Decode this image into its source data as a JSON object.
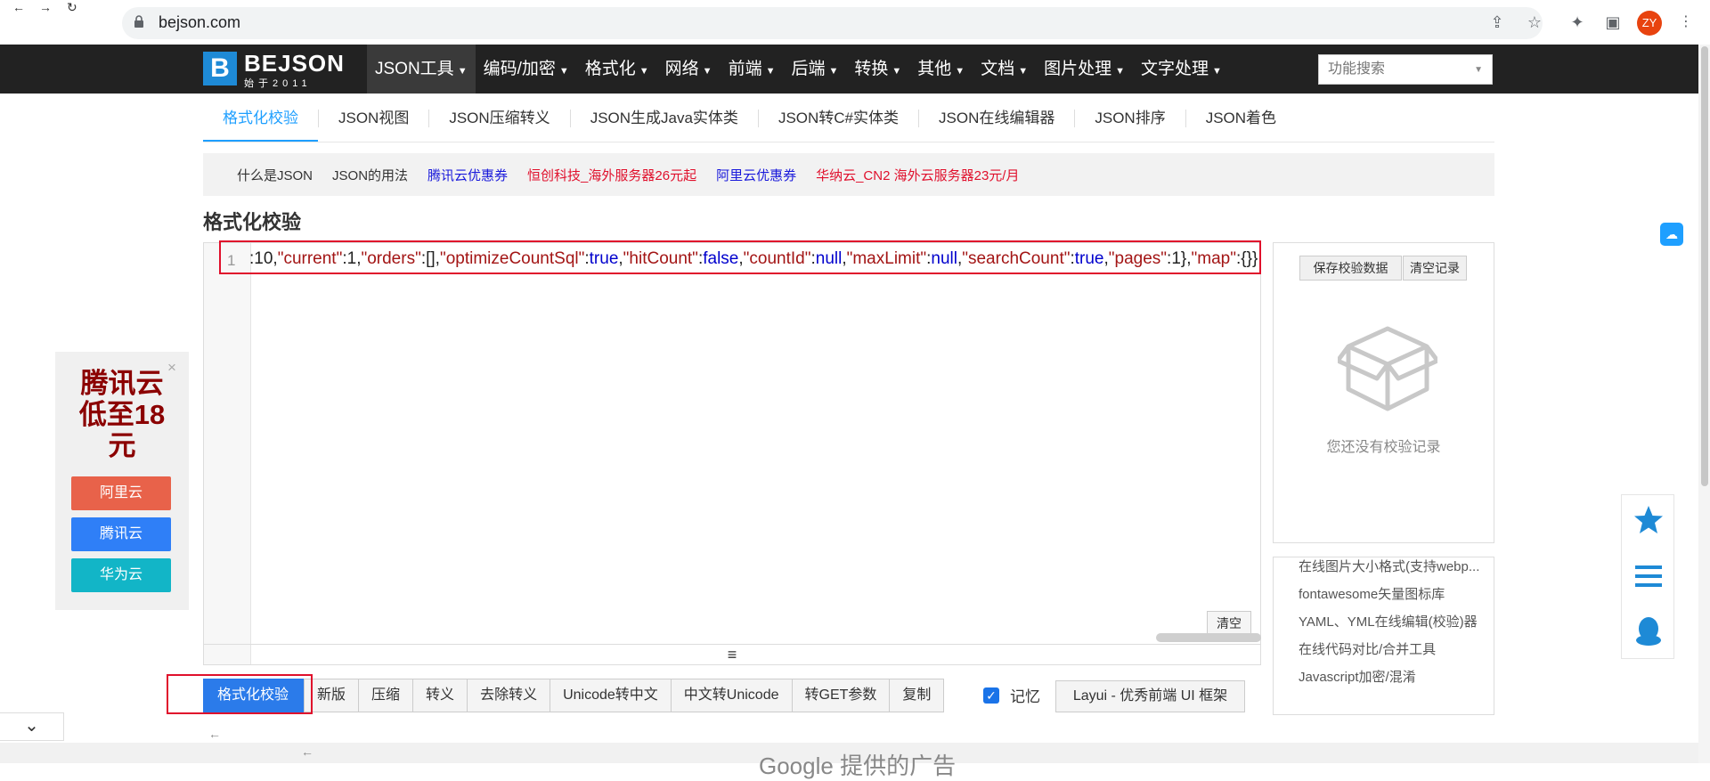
{
  "browser": {
    "url": "bejson.com",
    "profile_initials": "ZY"
  },
  "site": {
    "logo_title": "BEJSON",
    "logo_sub": "始于2011",
    "menu": [
      {
        "label": "JSON工具"
      },
      {
        "label": "编码/加密"
      },
      {
        "label": "格式化"
      },
      {
        "label": "网络"
      },
      {
        "label": "前端"
      },
      {
        "label": "后端"
      },
      {
        "label": "转换"
      },
      {
        "label": "其他"
      },
      {
        "label": "文档"
      },
      {
        "label": "图片处理"
      },
      {
        "label": "文字处理"
      }
    ],
    "search_placeholder": "功能搜索"
  },
  "subtabs": [
    {
      "label": "格式化校验"
    },
    {
      "label": "JSON视图"
    },
    {
      "label": "JSON压缩转义"
    },
    {
      "label": "JSON生成Java实体类"
    },
    {
      "label": "JSON转C#实体类"
    },
    {
      "label": "JSON在线编辑器"
    },
    {
      "label": "JSON排序"
    },
    {
      "label": "JSON着色"
    }
  ],
  "links": [
    {
      "label": "什么是JSON",
      "color": "#333333"
    },
    {
      "label": "JSON的用法",
      "color": "#333333"
    },
    {
      "label": "腾讯云优惠券",
      "color": "#1a1adb"
    },
    {
      "label": "恒创科技_海外服务器26元起",
      "color": "#e0102c"
    },
    {
      "label": "阿里云优惠券",
      "color": "#1a1adb"
    },
    {
      "label": "华纳云_CN2 海外云服务器23元/月",
      "color": "#e0102c"
    }
  ],
  "section_title": "格式化校验",
  "editor": {
    "line_number": "1",
    "code_line": ":10,\"current\":1,\"orders\":[],\"optimizeCountSql\":true,\"hitCount\":false,\"countId\":null,\"maxLimit\":null,\"searchCount\":true,\"pages\":1},\"map\":{}}",
    "clear_label": "清空"
  },
  "history": {
    "save_label": "保存校验数据",
    "clear_label": "清空记录",
    "empty_text": "您还没有校验记录"
  },
  "side_links": [
    "在线图片大小格式(支持webp...",
    "fontawesome矢量图标库",
    "YAML、YML在线编辑(校验)器",
    "在线代码对比/合并工具",
    "Javascript加密/混淆"
  ],
  "toolbar": {
    "buttons": [
      "格式化校验",
      "新版",
      "压缩",
      "转义",
      "去除转义",
      "Unicode转中文",
      "中文转Unicode",
      "转GET参数",
      "复制"
    ],
    "remember_label": "记忆",
    "layui_label": "Layui - 优秀前端 UI 框架"
  },
  "ad": {
    "title": "腾讯云低至18元",
    "buttons": [
      {
        "label": "阿里云",
        "color": "#e8624a"
      },
      {
        "label": "腾讯云",
        "color": "#2f7ff7"
      },
      {
        "label": "华为云",
        "color": "#12b5c7"
      }
    ]
  },
  "bottom_ad_text": "Google 提供的广告",
  "colors": {
    "accent": "#1e9fff",
    "primary_button": "#2b7bea",
    "highlight_box": "#e0102c"
  }
}
